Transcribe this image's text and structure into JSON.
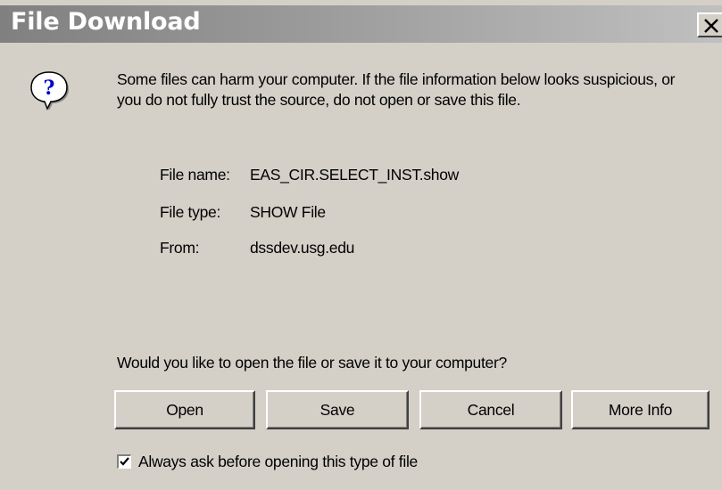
{
  "window": {
    "title": "File Download",
    "close_label": "×"
  },
  "icons": {
    "info": "question-mark-bubble-icon",
    "close": "close-icon",
    "checkbox": "checkmark-icon"
  },
  "message": {
    "warning": "Some files can harm your computer. If the file information below looks suspicious, or you do not fully trust the source, do not open or save this file."
  },
  "file_info": {
    "name_label": "File name:",
    "name_value": "EAS_CIR.SELECT_INST.show",
    "type_label": "File type:",
    "type_value": "SHOW File",
    "from_label": "From:",
    "from_value": "dssdev.usg.edu"
  },
  "prompt": {
    "question": "Would you like to open the file or save it to your computer?"
  },
  "buttons": {
    "open": "Open",
    "save": "Save",
    "cancel": "Cancel",
    "more_info": "More Info"
  },
  "options": {
    "always_ask_label": "Always ask before opening this type of file",
    "always_ask_checked": true
  },
  "colors": {
    "dialog_bg": "#d4d0c8",
    "titlebar_start": "#808080",
    "titlebar_end": "#c0c0c0",
    "title_text": "#ffffff",
    "icon_blue": "#0000cc"
  }
}
